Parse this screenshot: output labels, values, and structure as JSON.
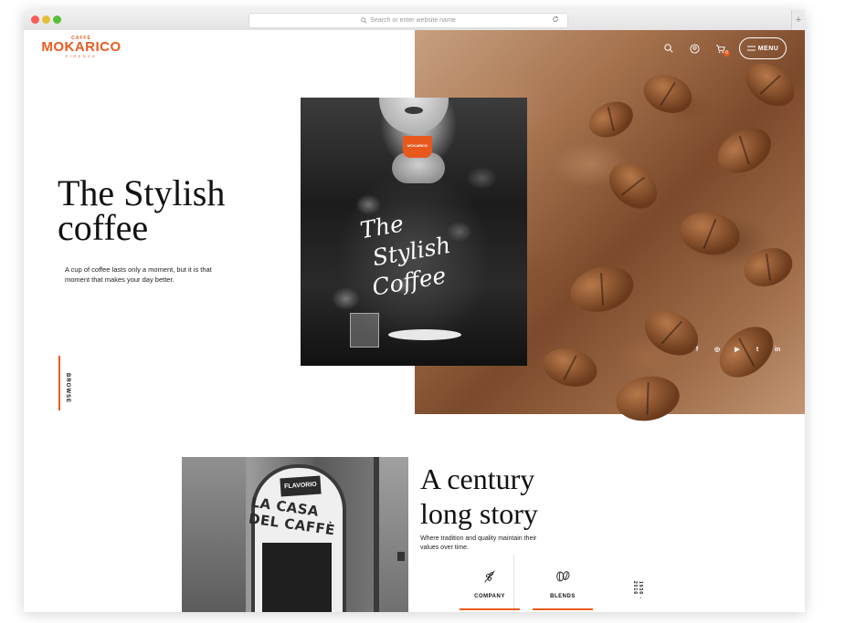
{
  "browser": {
    "url_placeholder": "Search or enter website name",
    "new_tab": "+"
  },
  "logo": {
    "caffe": "CAFFÈ",
    "brand": "MOKARICO",
    "city": "FIRENZE"
  },
  "nav": {
    "menu_label": "MENU",
    "cart_count": "0"
  },
  "hero": {
    "title_line1": "The Stylish",
    "title_line2": "coffee",
    "text": "A cup of coffee lasts only a moment, but it is that moment that makes your day better.",
    "browse": "BROWSE",
    "photo_script_line1": "The",
    "photo_script_line2": "Stylish",
    "photo_script_line3": "Coffee",
    "cup_label": "MOKARICO"
  },
  "social": {
    "facebook": "f",
    "instagram": "◎",
    "youtube": "▶",
    "twitter": "t",
    "linkedin": "in"
  },
  "story": {
    "title_line1": "A century",
    "title_line2": "long story",
    "text": "Where tradition and quality maintain their values over time.",
    "shop_sign_small": "FLAVORIO",
    "shop_sign_large": "LA CASA DEL CAFFÈ",
    "features": [
      {
        "label": "COMPANY",
        "icon": "coffee-branch-icon"
      },
      {
        "label": "BLENDS",
        "icon": "coffee-beans-icon"
      }
    ],
    "years": "1936 - 2016"
  },
  "colors": {
    "accent": "#e85b1e",
    "text": "#111111"
  }
}
